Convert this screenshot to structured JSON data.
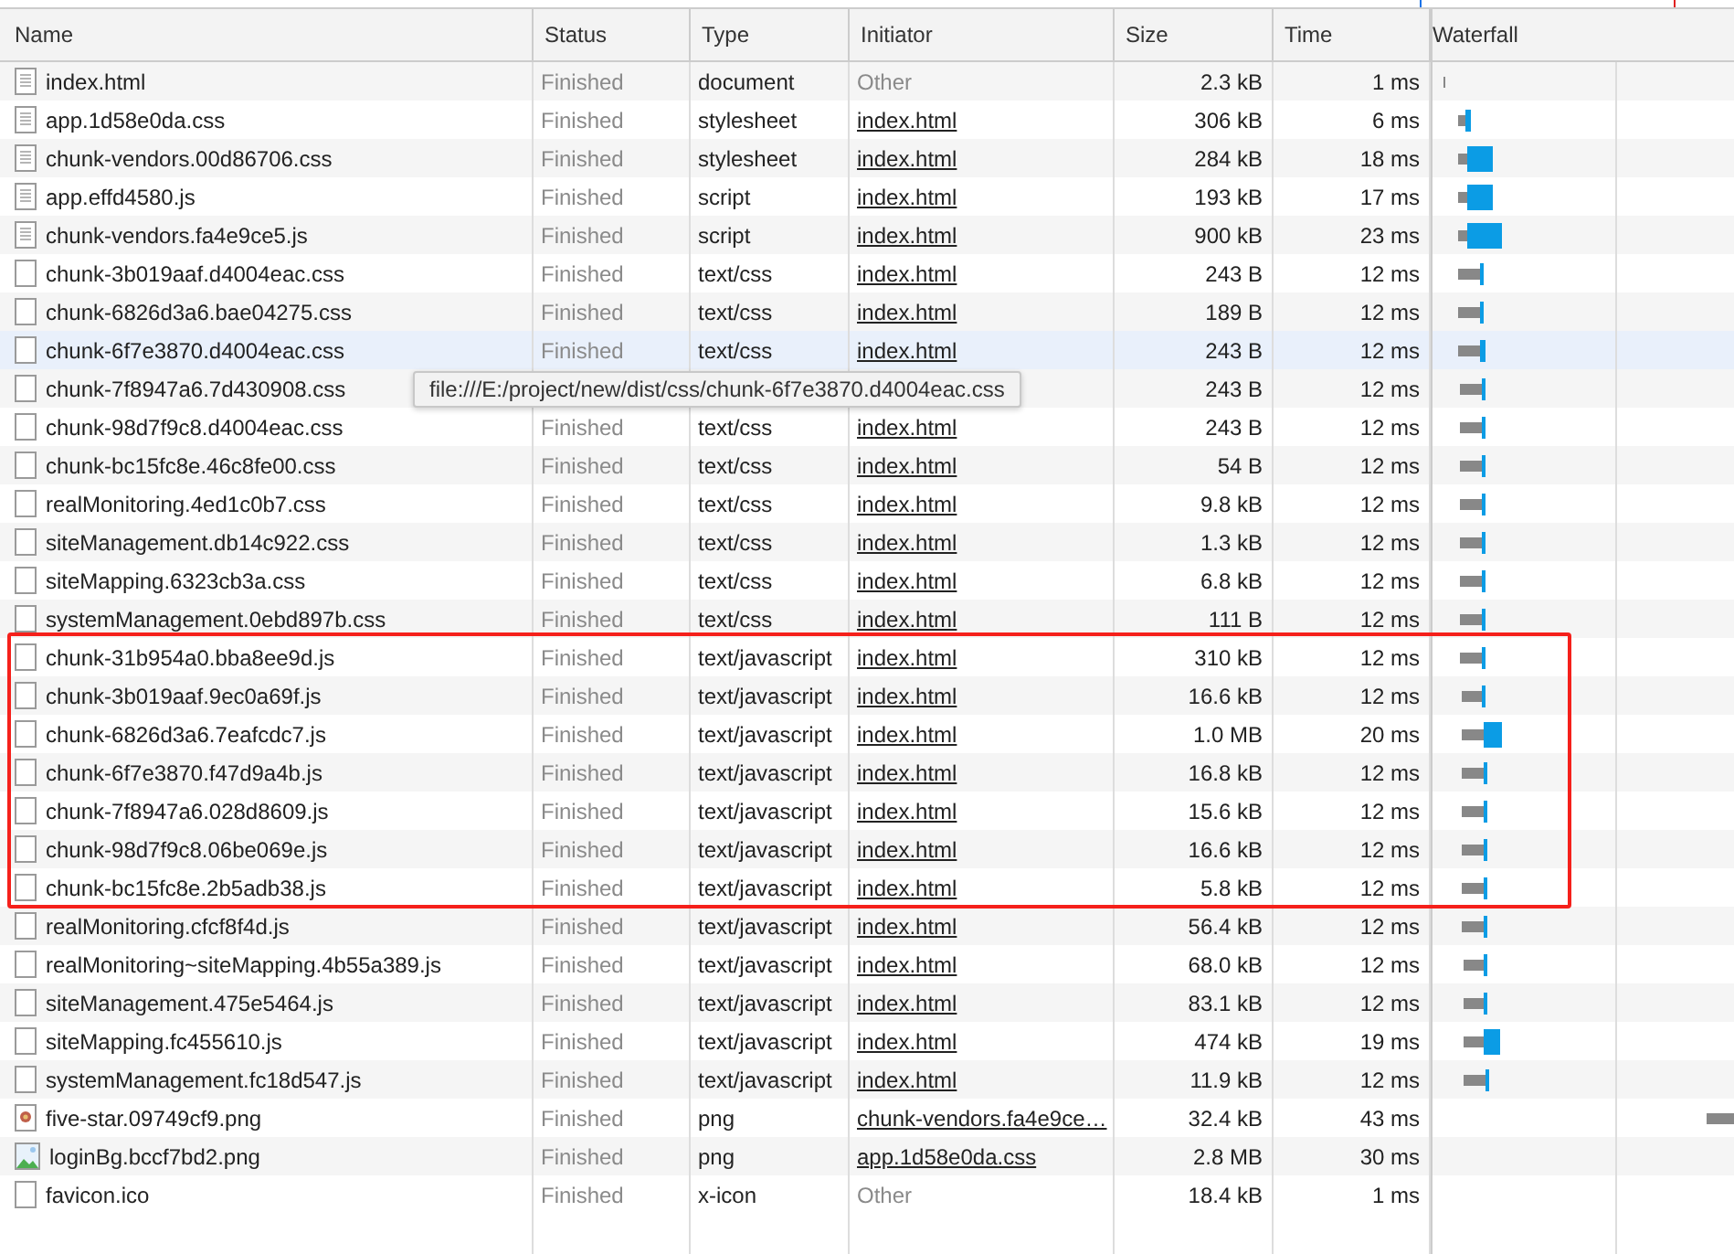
{
  "columns": [
    "Name",
    "Status",
    "Type",
    "Initiator",
    "Size",
    "Time",
    "Waterfall"
  ],
  "rows": [
    {
      "kind": "document",
      "name": "index.html",
      "status": "Finished",
      "type": "document",
      "initiator": "Other",
      "initiator_link": false,
      "size": "2.3 kB",
      "time": "1 ms",
      "hovered": false,
      "annotated": false
    },
    {
      "kind": "document",
      "name": "app.1d58e0da.css",
      "status": "Finished",
      "type": "stylesheet",
      "initiator": "index.html",
      "initiator_link": true,
      "size": "306 kB",
      "time": "6 ms",
      "hovered": false,
      "annotated": false
    },
    {
      "kind": "document",
      "name": "chunk-vendors.00d86706.css",
      "status": "Finished",
      "type": "stylesheet",
      "initiator": "index.html",
      "initiator_link": true,
      "size": "284 kB",
      "time": "18 ms",
      "hovered": false,
      "annotated": false
    },
    {
      "kind": "document",
      "name": "app.effd4580.js",
      "status": "Finished",
      "type": "script",
      "initiator": "index.html",
      "initiator_link": true,
      "size": "193 kB",
      "time": "17 ms",
      "hovered": false,
      "annotated": false
    },
    {
      "kind": "document",
      "name": "chunk-vendors.fa4e9ce5.js",
      "status": "Finished",
      "type": "script",
      "initiator": "index.html",
      "initiator_link": true,
      "size": "900 kB",
      "time": "23 ms",
      "hovered": false,
      "annotated": false
    },
    {
      "kind": "blank",
      "name": "chunk-3b019aaf.d4004eac.css",
      "status": "Finished",
      "type": "text/css",
      "initiator": "index.html",
      "initiator_link": true,
      "size": "243 B",
      "time": "12 ms",
      "hovered": false,
      "annotated": false
    },
    {
      "kind": "blank",
      "name": "chunk-6826d3a6.bae04275.css",
      "status": "Finished",
      "type": "text/css",
      "initiator": "index.html",
      "initiator_link": true,
      "size": "189 B",
      "time": "12 ms",
      "hovered": false,
      "annotated": false
    },
    {
      "kind": "blank",
      "name": "chunk-6f7e3870.d4004eac.css",
      "status": "Finished",
      "type": "text/css",
      "initiator": "index.html",
      "initiator_link": true,
      "size": "243 B",
      "time": "12 ms",
      "hovered": true,
      "annotated": false
    },
    {
      "kind": "blank",
      "name": "chunk-7f8947a6.7d430908.css",
      "size": "243 B",
      "time": "12 ms",
      "hovered": false,
      "annotated": false
    },
    {
      "kind": "blank",
      "name": "chunk-98d7f9c8.d4004eac.css",
      "status": "Finished",
      "type": "text/css",
      "initiator": "index.html",
      "initiator_link": true,
      "size": "243 B",
      "time": "12 ms",
      "hovered": false,
      "annotated": false
    },
    {
      "kind": "blank",
      "name": "chunk-bc15fc8e.46c8fe00.css",
      "status": "Finished",
      "type": "text/css",
      "initiator": "index.html",
      "initiator_link": true,
      "size": "54 B",
      "time": "12 ms",
      "hovered": false,
      "annotated": false
    },
    {
      "kind": "blank",
      "name": "realMonitoring.4ed1c0b7.css",
      "status": "Finished",
      "type": "text/css",
      "initiator": "index.html",
      "initiator_link": true,
      "size": "9.8 kB",
      "time": "12 ms",
      "hovered": false,
      "annotated": false
    },
    {
      "kind": "blank",
      "name": "siteManagement.db14c922.css",
      "status": "Finished",
      "type": "text/css",
      "initiator": "index.html",
      "initiator_link": true,
      "size": "1.3 kB",
      "time": "12 ms",
      "hovered": false,
      "annotated": false
    },
    {
      "kind": "blank",
      "name": "siteMapping.6323cb3a.css",
      "status": "Finished",
      "type": "text/css",
      "initiator": "index.html",
      "initiator_link": true,
      "size": "6.8 kB",
      "time": "12 ms",
      "hovered": false,
      "annotated": false
    },
    {
      "kind": "blank",
      "name": "systemManagement.0ebd897b.css",
      "status": "Finished",
      "type": "text/css",
      "initiator": "index.html",
      "initiator_link": true,
      "size": "111 B",
      "time": "12 ms",
      "hovered": false,
      "annotated": false
    },
    {
      "kind": "blank",
      "name": "chunk-31b954a0.bba8ee9d.js",
      "status": "Finished",
      "type": "text/javascript",
      "initiator": "index.html",
      "initiator_link": true,
      "size": "310 kB",
      "time": "12 ms",
      "hovered": false,
      "annotated": true
    },
    {
      "kind": "blank",
      "name": "chunk-3b019aaf.9ec0a69f.js",
      "status": "Finished",
      "type": "text/javascript",
      "initiator": "index.html",
      "initiator_link": true,
      "size": "16.6 kB",
      "time": "12 ms",
      "hovered": false,
      "annotated": true
    },
    {
      "kind": "blank",
      "name": "chunk-6826d3a6.7eafcdc7.js",
      "status": "Finished",
      "type": "text/javascript",
      "initiator": "index.html",
      "initiator_link": true,
      "size": "1.0 MB",
      "time": "20 ms",
      "hovered": false,
      "annotated": true
    },
    {
      "kind": "blank",
      "name": "chunk-6f7e3870.f47d9a4b.js",
      "status": "Finished",
      "type": "text/javascript",
      "initiator": "index.html",
      "initiator_link": true,
      "size": "16.8 kB",
      "time": "12 ms",
      "hovered": false,
      "annotated": true
    },
    {
      "kind": "blank",
      "name": "chunk-7f8947a6.028d8609.js",
      "status": "Finished",
      "type": "text/javascript",
      "initiator": "index.html",
      "initiator_link": true,
      "size": "15.6 kB",
      "time": "12 ms",
      "hovered": false,
      "annotated": true
    },
    {
      "kind": "blank",
      "name": "chunk-98d7f9c8.06be069e.js",
      "status": "Finished",
      "type": "text/javascript",
      "initiator": "index.html",
      "initiator_link": true,
      "size": "16.6 kB",
      "time": "12 ms",
      "hovered": false,
      "annotated": true
    },
    {
      "kind": "blank",
      "name": "chunk-bc15fc8e.2b5adb38.js",
      "status": "Finished",
      "type": "text/javascript",
      "initiator": "index.html",
      "initiator_link": true,
      "size": "5.8 kB",
      "time": "12 ms",
      "hovered": false,
      "annotated": true
    },
    {
      "kind": "blank",
      "name": "realMonitoring.cfcf8f4d.js",
      "status": "Finished",
      "type": "text/javascript",
      "initiator": "index.html",
      "initiator_link": true,
      "size": "56.4 kB",
      "time": "12 ms",
      "hovered": false,
      "annotated": false
    },
    {
      "kind": "blank",
      "name": "realMonitoring~siteMapping.4b55a389.js",
      "status": "Finished",
      "type": "text/javascript",
      "initiator": "index.html",
      "initiator_link": true,
      "size": "68.0 kB",
      "time": "12 ms",
      "hovered": false,
      "annotated": false
    },
    {
      "kind": "blank",
      "name": "siteManagement.475e5464.js",
      "status": "Finished",
      "type": "text/javascript",
      "initiator": "index.html",
      "initiator_link": true,
      "size": "83.1 kB",
      "time": "12 ms",
      "hovered": false,
      "annotated": false
    },
    {
      "kind": "blank",
      "name": "siteMapping.fc455610.js",
      "status": "Finished",
      "type": "text/javascript",
      "initiator": "index.html",
      "initiator_link": true,
      "size": "474 kB",
      "time": "19 ms",
      "hovered": false,
      "annotated": false
    },
    {
      "kind": "blank",
      "name": "systemManagement.fc18d547.js",
      "status": "Finished",
      "type": "text/javascript",
      "initiator": "index.html",
      "initiator_link": true,
      "size": "11.9 kB",
      "time": "12 ms",
      "hovered": false,
      "annotated": false
    },
    {
      "kind": "image-dot",
      "name": "five-star.09749cf9.png",
      "status": "Finished",
      "type": "png",
      "initiator": "chunk-vendors.fa4e9ce…",
      "initiator_link": true,
      "size": "32.4 kB",
      "time": "43 ms",
      "hovered": false,
      "annotated": false
    },
    {
      "kind": "image",
      "name": "loginBg.bccf7bd2.png",
      "status": "Finished",
      "type": "png",
      "initiator": "app.1d58e0da.css",
      "initiator_link": true,
      "size": "2.8 MB",
      "time": "30 ms",
      "hovered": false,
      "annotated": false
    },
    {
      "kind": "blank",
      "name": "favicon.ico",
      "status": "Finished",
      "type": "x-icon",
      "initiator": "Other",
      "initiator_link": false,
      "size": "18.4 kB",
      "time": "1 ms",
      "hovered": false,
      "annotated": false
    }
  ],
  "tooltip": {
    "text": "file:///E:/project/new/dist/css/chunk-6f7e3870.d4004eac.css"
  }
}
